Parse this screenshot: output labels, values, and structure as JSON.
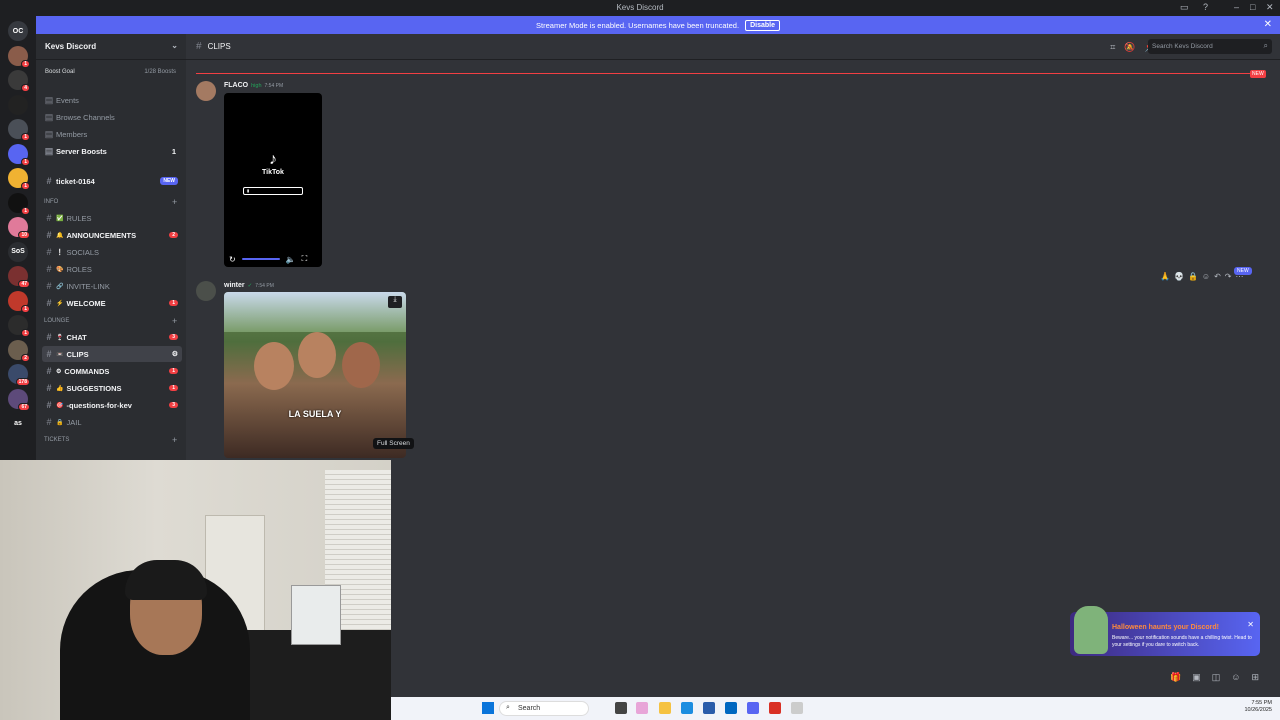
{
  "window": {
    "title": "Kevs Discord"
  },
  "banner": {
    "text": "Streamer Mode is enabled. Usernames have been truncated.",
    "button": "Disable"
  },
  "servers": [
    {
      "label": "OC",
      "color": "#36393f",
      "badge": ""
    },
    {
      "label": "",
      "color": "#8a5c4a",
      "badge": "1"
    },
    {
      "label": "",
      "color": "#3a3a3a",
      "badge": "4"
    },
    {
      "label": "",
      "color": "#222",
      "badge": ""
    },
    {
      "label": "",
      "color": "#4a4f57",
      "badge": "1"
    },
    {
      "label": "",
      "color": "#5865f2",
      "badge": "1"
    },
    {
      "label": "",
      "color": "#f0b232",
      "badge": "1"
    },
    {
      "label": "",
      "color": "#111",
      "badge": "1"
    },
    {
      "label": "",
      "color": "#e07a9a",
      "badge": "10"
    },
    {
      "label": "SoS",
      "color": "#2b2d31",
      "badge": ""
    },
    {
      "label": "",
      "color": "#7a3030",
      "badge": "47"
    },
    {
      "label": "",
      "color": "#c0392b",
      "badge": "1"
    },
    {
      "label": "",
      "color": "#2c2c2c",
      "badge": "1"
    },
    {
      "label": "",
      "color": "#6b5e4e",
      "badge": "2"
    },
    {
      "label": "",
      "color": "#3a4a6a",
      "badge": "178"
    },
    {
      "label": "",
      "color": "#5d4a7a",
      "badge": "67"
    },
    {
      "label": "as",
      "color": "#1e1f22",
      "badge": ""
    }
  ],
  "server": {
    "name": "Kevs Discord",
    "boost_goal": "Boost Goal",
    "boost_count": "1/28 Boosts",
    "menu": [
      {
        "label": "Events",
        "icon": "calendar-icon",
        "count": ""
      },
      {
        "label": "Browse Channels",
        "icon": "browse-icon",
        "count": ""
      },
      {
        "label": "Members",
        "icon": "members-icon",
        "count": ""
      },
      {
        "label": "Server Boosts",
        "icon": "boost-icon",
        "count": "1"
      }
    ],
    "ticket": {
      "name": "ticket-0164",
      "tag": "NEW"
    },
    "categories": [
      {
        "name": "INFO",
        "channels": [
          {
            "name": "RULES",
            "emoji": "✅",
            "count": "",
            "bright": false
          },
          {
            "name": "ANNOUNCEMENTS",
            "emoji": "🔔",
            "count": "2",
            "bright": true
          },
          {
            "name": "SOCIALS",
            "emoji": "❕",
            "count": "",
            "bright": false
          },
          {
            "name": "ROLES",
            "emoji": "🎨",
            "count": "",
            "bright": false
          },
          {
            "name": "INVITE-LINK",
            "emoji": "🔗",
            "count": "",
            "bright": false
          },
          {
            "name": "WELCOME",
            "emoji": "⚡",
            "count": "1",
            "bright": true
          }
        ]
      },
      {
        "name": "LOUNGE",
        "channels": [
          {
            "name": "CHAT",
            "emoji": "🍷",
            "count": "3",
            "bright": true
          },
          {
            "name": "CLIPS",
            "emoji": "📼",
            "count": "",
            "bright": true,
            "active": true
          },
          {
            "name": "COMMANDS",
            "emoji": "⚙",
            "count": "1",
            "bright": true
          },
          {
            "name": "SUGGESTIONS",
            "emoji": "👍",
            "count": "1",
            "bright": true
          },
          {
            "name": "-questions-for-kev",
            "emoji": "🎯",
            "count": "3",
            "bright": true
          },
          {
            "name": "JAIL",
            "emoji": "🔒",
            "count": "",
            "bright": false
          }
        ]
      },
      {
        "name": "Tickets",
        "channels": []
      }
    ]
  },
  "channel": {
    "name": "CLIPS",
    "search_placeholder": "Search Kevs Discord",
    "new_tag": "NEW"
  },
  "messages": [
    {
      "author": "FLACO",
      "tag": "high",
      "time": "7:54 PM",
      "video": {
        "brand": "TikTok"
      }
    },
    {
      "author": "winter",
      "tag": "",
      "time": "7:54 PM",
      "video": {
        "caption": "LA SUELA Y"
      }
    }
  ],
  "tooltip": "Full Screen",
  "hover_new": "NEW",
  "notification": {
    "title": "Halloween haunts your Discord!",
    "body": "Beware... your notification sounds have a chilling twist. Head to your settings if you dare to switch back."
  },
  "taskbar": {
    "search": "Search",
    "time": "7:55 PM",
    "date": "10/26/2025"
  }
}
